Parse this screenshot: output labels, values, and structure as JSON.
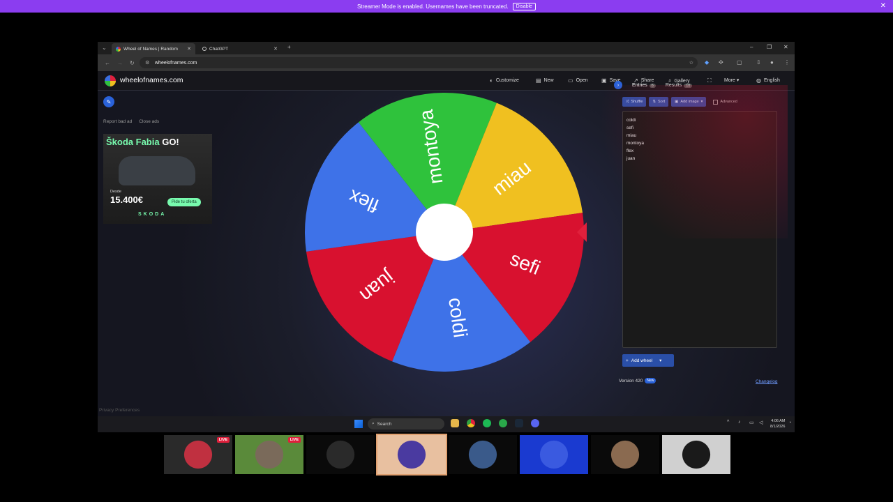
{
  "streamer_bar": {
    "message": "Streamer Mode is enabled. Usernames have been truncated.",
    "disable_label": "Disable",
    "close": "✕"
  },
  "browser": {
    "tabs": [
      {
        "label": "Wheel of Names | Random",
        "close": "✕"
      },
      {
        "label": "ChatGPT",
        "close": "✕"
      }
    ],
    "new_tab": "+",
    "window_controls": {
      "minimize": "–",
      "restore": "❐",
      "close": "✕"
    },
    "url": "wheelofnames.com"
  },
  "site": {
    "brand": "wheelofnames.com",
    "menu": [
      {
        "icon": "palette-icon",
        "glyph": "◐",
        "label": "Customize"
      },
      {
        "icon": "file-icon",
        "glyph": "▤",
        "label": "New"
      },
      {
        "icon": "folder-icon",
        "glyph": "▭",
        "label": "Open"
      },
      {
        "icon": "save-icon",
        "glyph": "▣",
        "label": "Save"
      },
      {
        "icon": "share-icon",
        "glyph": "↗",
        "label": "Share"
      },
      {
        "icon": "search-icon",
        "glyph": "⌕",
        "label": "Gallery"
      },
      {
        "icon": "fullscreen-icon",
        "glyph": "⛶",
        "label": ""
      },
      {
        "icon": "more-icon",
        "glyph": "",
        "label": "More ▾"
      },
      {
        "icon": "globe-icon",
        "glyph": "◍",
        "label": "English"
      }
    ],
    "report_ad": "Report bad ad",
    "close_ads": "Close ads",
    "ad": {
      "title": "Škoda Fabia",
      "title_go": "GO!",
      "desde": "Desde",
      "price": "15.400€",
      "cta": "Pide tu oferta",
      "brand": "SKODA"
    },
    "privacy": "Privacy Preferences"
  },
  "wheel": {
    "segments": [
      {
        "label": "montoya",
        "color": "#2fc23c"
      },
      {
        "label": "miau",
        "color": "#f0c020"
      },
      {
        "label": "sefi",
        "color": "#d8112f"
      },
      {
        "label": "coldi",
        "color": "#3e72e8"
      },
      {
        "label": "juan",
        "color": "#d8112f"
      },
      {
        "label": "flex",
        "color": "#3e72e8"
      }
    ],
    "pointer_color": "#e0203c"
  },
  "panel": {
    "tab_entries": "Entries",
    "entries_count": "6",
    "tab_results": "Results",
    "results_count": "10",
    "shuffle": "Shuffle",
    "sort": "Sort",
    "add_image": "Add image",
    "advanced": "Advanced",
    "entries": [
      "coldi",
      "sefi",
      "miau",
      "montoya",
      "flex",
      "juan"
    ],
    "add_wheel": "Add wheel",
    "version": "Version 420",
    "new_badge": "New",
    "changelog": "Changelog"
  },
  "taskbar": {
    "search": "Search",
    "time": "4:06 AM",
    "date": "8/1/2026"
  },
  "thumbnails": [
    {
      "live": "LIVE",
      "colors": [
        "#2a2a2a",
        "#c03040"
      ]
    },
    {
      "live": "LIVE",
      "colors": [
        "#5a8a3a",
        "#7a6a5a"
      ]
    },
    {
      "live": "",
      "colors": [
        "#0a0a0a",
        "#2a2a2a"
      ]
    },
    {
      "live": "",
      "colors": [
        "#e8c0a0",
        "#4a3aa0"
      ]
    },
    {
      "live": "",
      "colors": [
        "#0a0a0a",
        "#3a5a8a"
      ]
    },
    {
      "live": "",
      "colors": [
        "#1a3ad0",
        "#3a5ae0"
      ]
    },
    {
      "live": "",
      "colors": [
        "#0a0a0a",
        "#8a6a50"
      ]
    },
    {
      "live": "",
      "colors": [
        "#d0d0d0",
        "#1a1a1a"
      ]
    }
  ]
}
